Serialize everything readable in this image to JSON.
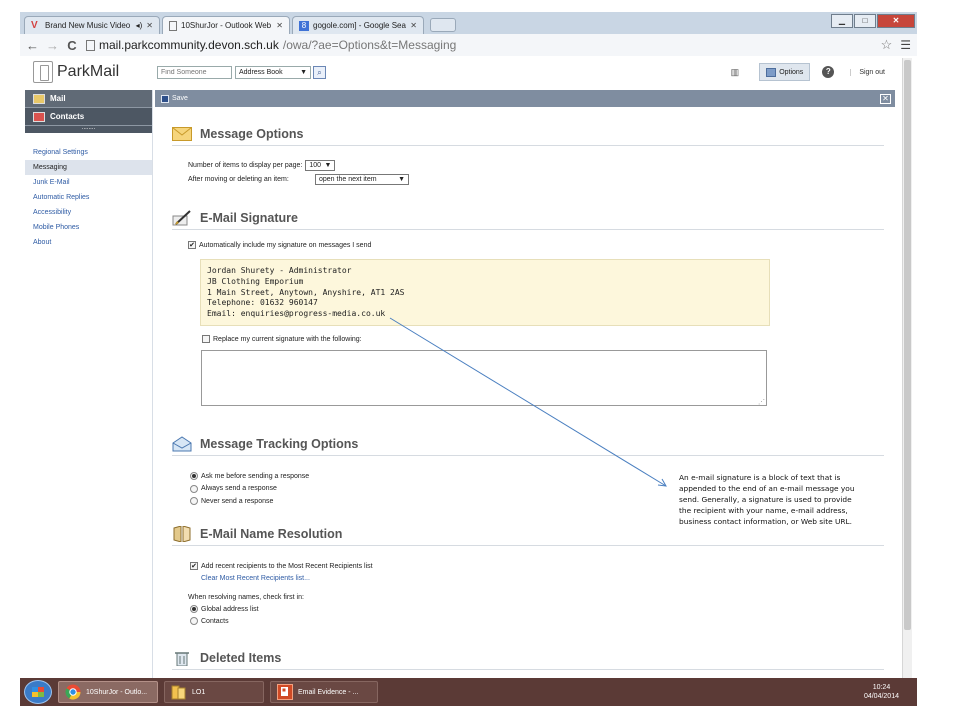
{
  "browser": {
    "tabs": [
      {
        "title": "Brand New Music Video",
        "favicon": "vevo-icon",
        "extra": "audio-icon"
      },
      {
        "title": "10ShurJor - Outlook Web",
        "favicon": "page-icon"
      },
      {
        "title": "gogole.com] - Google Sea",
        "favicon": "google-icon"
      }
    ],
    "url_host": "mail.parkcommunity.devon.sch.uk",
    "url_path": "/owa/?ae=Options&t=Messaging"
  },
  "app": {
    "logo_text": "ParkMail",
    "find_placeholder": "Find Someone",
    "address_book_label": "Address Book",
    "options_label": "Options",
    "help_label": "?",
    "signout_label": "Sign out"
  },
  "sidebar": {
    "primary": [
      {
        "label": "Mail"
      },
      {
        "label": "Contacts"
      }
    ],
    "items": [
      {
        "label": "Regional Settings"
      },
      {
        "label": "Messaging"
      },
      {
        "label": "Junk E-Mail"
      },
      {
        "label": "Automatic Replies"
      },
      {
        "label": "Accessibility"
      },
      {
        "label": "Mobile Phones"
      },
      {
        "label": "About"
      }
    ],
    "selected": "Messaging"
  },
  "toolbar": {
    "save_label": "Save",
    "close_label": "✕"
  },
  "message_options": {
    "title": "Message Options",
    "items_per_page_label": "Number of items to display per page:",
    "items_per_page_value": "100",
    "after_moving_label": "After moving or deleting an item:",
    "after_moving_value": "open the next item"
  },
  "signature": {
    "title": "E-Mail Signature",
    "auto_include_label": "Automatically include my signature on messages I send",
    "auto_include_checked": true,
    "lines": [
      "Jordan Shurety - Administrator",
      "JB Clothing Emporium",
      "1 Main Street, Anytown, Anyshire, AT1 2AS",
      "Telephone: 01632 960147",
      "Email: enquiries@progress-media.co.uk"
    ],
    "replace_label": "Replace my current signature with the following:",
    "replace_checked": false
  },
  "tracking": {
    "title": "Message Tracking Options",
    "options": [
      {
        "label": "Ask me before sending a response",
        "selected": true
      },
      {
        "label": "Always send a response",
        "selected": false
      },
      {
        "label": "Never send a response",
        "selected": false
      }
    ]
  },
  "name_resolution": {
    "title": "E-Mail Name Resolution",
    "recent_label": "Add recent recipients to the Most Recent Recipients list",
    "recent_checked": true,
    "clear_link": "Clear Most Recent Recipients list...",
    "check_first_label": "When resolving names, check first in:",
    "options": [
      {
        "label": "Global address list",
        "selected": true
      },
      {
        "label": "Contacts",
        "selected": false
      }
    ]
  },
  "deleted": {
    "title": "Deleted Items"
  },
  "annotation": {
    "text": "An e-mail signature is a block of text that is appended to the end of an e-mail message you send. Generally, a signature is used to provide the recipient with your name, e-mail address, business contact information, or Web site URL."
  },
  "taskbar": {
    "items": [
      {
        "label": "10ShurJor - Outlo...",
        "icon": "chrome-icon"
      },
      {
        "label": "LO1",
        "icon": "folder-icon"
      },
      {
        "label": "Email Evidence - ...",
        "icon": "powerpoint-icon"
      }
    ],
    "time": "10:24",
    "date": "04/04/2014"
  },
  "colors": {
    "toolbar": "#7f8da0",
    "signature_bg": "#fdf7dc",
    "link": "#2e5ba4",
    "taskbar": "#5b3a36",
    "nav_dark": "#606a76"
  }
}
